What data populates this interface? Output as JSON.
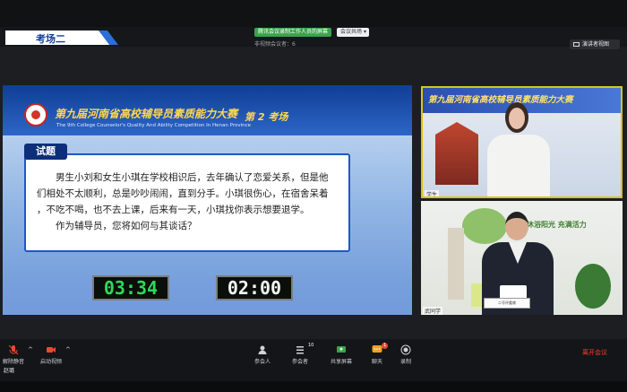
{
  "header": {
    "room_label": "考场二",
    "recording_label": "腾讯会议录制工作人员的屏幕",
    "layout_dropdown": "会议共场",
    "meta_text": "非视频会议者：6",
    "speaker_view_label": "演讲者视图"
  },
  "slide": {
    "title_cn": "第九届河南省高校辅导员素质能力大赛",
    "title_en": "The 9th College Counselor's Quality And Ability Competition In Henan Province",
    "room_text": "第 2 考场",
    "question_tab": "试题",
    "question_lines": [
      "男生小刘和女生小琪在学校相识后，去年确认了恋爱关系，但是他",
      "们相处不太顺利，总是吵吵闹闹，直到分手。小琪很伤心，在宿舍呆着",
      "，不吃不喝，也不去上课，后来有一天，小琪找你表示想要退学。",
      "作为辅导员，您将如何与其谈话？"
    ],
    "timer_elapsed": "03:34",
    "timer_limit": "02:00"
  },
  "cam1": {
    "banner_text": "第九届河南省高校辅导员素质能力大赛",
    "name_tag": "学生"
  },
  "cam2": {
    "slogan": "沐浴阳光 充满活力",
    "nameplate": "二号评委席",
    "name_tag": "武同学"
  },
  "toolbar": {
    "mute_label": "解除静音",
    "video_label": "启动视频",
    "participants_label": "参会人",
    "attendees_label": "参会者",
    "attendees_badge": "10",
    "share_label": "共享屏幕",
    "chat_label": "聊天",
    "chat_badge": "1",
    "record_label": "录制",
    "leave_label": "离开会议",
    "user_name": "赵璐"
  },
  "colors": {
    "accent_blue": "#2b6fd6",
    "timer_green": "#2fd85a",
    "leave_red": "#ff3b30",
    "chat_orange": "#f4a020"
  }
}
